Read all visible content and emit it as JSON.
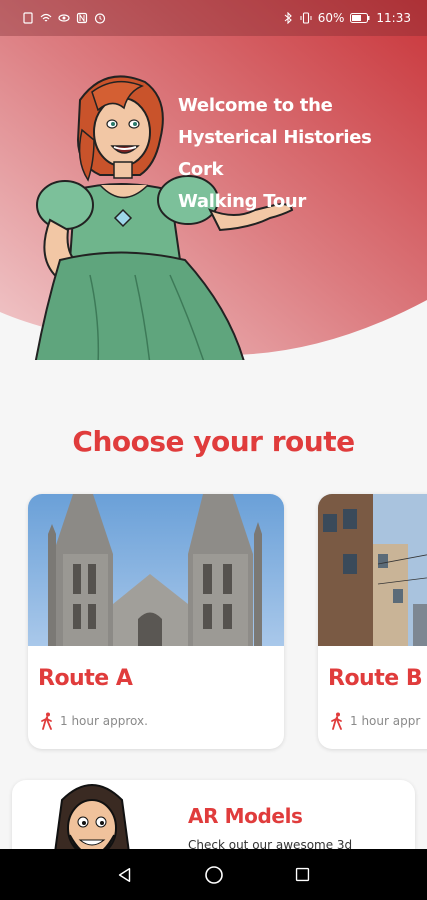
{
  "status_bar": {
    "battery": "60%",
    "time": "11:33"
  },
  "hero": {
    "welcome_line1": "Welcome to the",
    "welcome_line2": "Hysterical Histories Cork",
    "welcome_line3": "Walking Tour"
  },
  "section": {
    "title": "Choose your route"
  },
  "routes": [
    {
      "name": "Route A",
      "duration": "1 hour approx."
    },
    {
      "name": "Route B",
      "duration": "1 hour appr"
    }
  ],
  "ar": {
    "title": "AR Models",
    "description": "Check out our awesome 3d"
  },
  "colors": {
    "accent": "#e03c3c",
    "hero_start": "#e9a7aa",
    "hero_end": "#c9383c"
  },
  "icons": {
    "walk": "walking-person-icon",
    "back": "back-triangle-icon",
    "home": "home-circle-icon",
    "recents": "recents-square-icon"
  }
}
